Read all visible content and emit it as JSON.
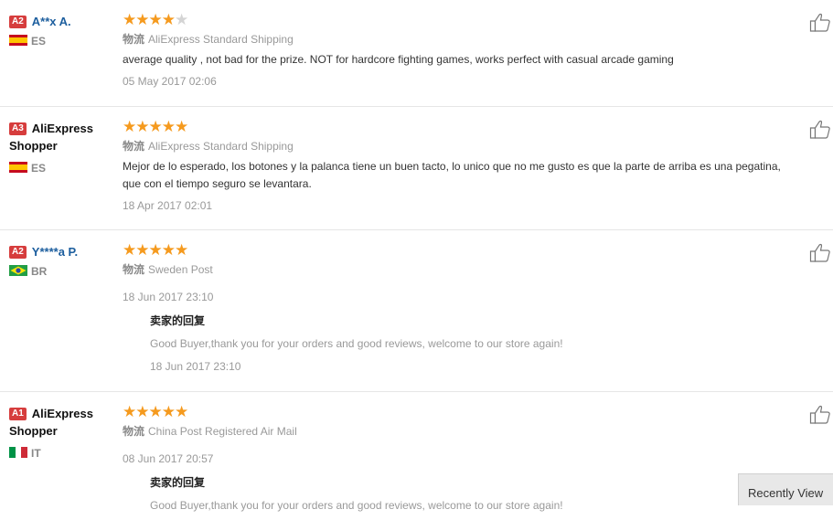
{
  "shipping_label": "物流",
  "reply_title": "卖家的回复",
  "colors": {
    "star": "#f59a1e",
    "badge": "#d63d3d",
    "link": "#1c5e9e"
  },
  "reviews": [
    {
      "level": "A2",
      "name": "A**x A.",
      "country": "ES",
      "rating": 4,
      "shipping": "AliExpress Standard Shipping",
      "text": "average quality , not bad for the prize. NOT for hardcore fighting games, works perfect with casual arcade gaming",
      "date": "05 May 2017 02:06"
    },
    {
      "level": "A3",
      "name": "AliExpress Shopper",
      "country": "ES",
      "rating": 5,
      "shipping": "AliExpress Standard Shipping",
      "text": "Mejor de lo esperado, los botones y la palanca tiene un buen tacto, lo unico que no me gusto es que la parte de arriba es una pegatina, que con el tiempo seguro se levantara.",
      "date": "18 Apr 2017 02:01"
    },
    {
      "level": "A2",
      "name": "Y****a P.",
      "country": "BR",
      "rating": 5,
      "shipping": "Sweden Post",
      "date": "18 Jun 2017 23:10",
      "reply_text": "Good Buyer,thank you for your orders and good reviews, welcome to our store again!",
      "reply_date": "18 Jun 2017 23:10"
    },
    {
      "level": "A1",
      "name": "AliExpress Shopper",
      "country": "IT",
      "rating": 5,
      "shipping": "China Post Registered Air Mail",
      "date": "08 Jun 2017 20:57",
      "reply_text": "Good Buyer,thank you for your orders and good reviews, welcome to our store again!"
    }
  ],
  "recently_view": "Recently View"
}
